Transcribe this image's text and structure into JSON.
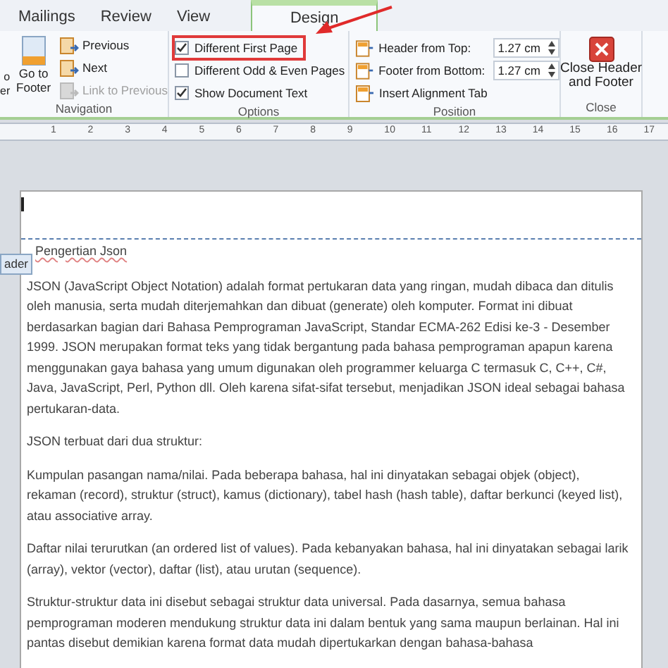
{
  "tabs": [
    {
      "label": "Mailings",
      "selected": false
    },
    {
      "label": "Review",
      "selected": false
    },
    {
      "label": "View",
      "selected": false
    },
    {
      "label": "Design",
      "selected": true
    }
  ],
  "navigation": {
    "label": "Navigation",
    "cut_button": [
      "o",
      "er"
    ],
    "goto": [
      "Go to",
      "Footer"
    ],
    "items": [
      {
        "label": "Previous",
        "disabled": false
      },
      {
        "label": "Next",
        "disabled": false
      },
      {
        "label": "Link to Previous",
        "disabled": true
      }
    ]
  },
  "options": {
    "label": "Options",
    "items": [
      {
        "label": "Different First Page",
        "checked": true,
        "highlighted": true
      },
      {
        "label": "Different Odd & Even Pages",
        "checked": false,
        "highlighted": false
      },
      {
        "label": "Show Document Text",
        "checked": true,
        "highlighted": false
      }
    ]
  },
  "position": {
    "label": "Position",
    "fields": [
      {
        "label": "Header from Top:",
        "value": "1.27 cm"
      },
      {
        "label": "Footer from Bottom:",
        "value": "1.27 cm"
      }
    ],
    "insert": "Insert Alignment Tab"
  },
  "close": {
    "label": "Close",
    "button": [
      "Close Header",
      "and Footer"
    ]
  },
  "ruler": [
    "1",
    "2",
    "3",
    "4",
    "5",
    "6",
    "7",
    "8",
    "9",
    "10",
    "11",
    "12",
    "13",
    "14",
    "15",
    "16",
    "17"
  ],
  "header_tag": "ader",
  "document": {
    "title": "Pengertian Json",
    "paragraphs": [
      "JSON (JavaScript Object Notation) adalah format pertukaran data yang ringan, mudah dibaca dan ditulis oleh manusia, serta mudah diterjemahkan dan dibuat (generate) oleh komputer. Format ini dibuat berdasarkan bagian dari Bahasa Pemprograman JavaScript, Standar ECMA-262 Edisi ke-3 - Desember 1999.  JSON merupakan format teks yang tidak bergantung pada bahasa pemprograman apapun karena menggunakan gaya bahasa yang umum digunakan oleh programmer keluarga C termasuk C, C++, C#, Java, JavaScript, Perl, Python dll.  Oleh karena sifat-sifat tersebut, menjadikan JSON ideal sebagai bahasa pertukaran-data.",
      "JSON terbuat dari dua struktur:",
      "Kumpulan pasangan nama/nilai. Pada beberapa bahasa, hal ini dinyatakan sebagai objek (object), rekaman (record), struktur (struct), kamus (dictionary), tabel hash (hash table), daftar berkunci (keyed list), atau associative array.",
      "Daftar nilai terurutkan (an ordered list of values). Pada kebanyakan bahasa, hal ini dinyatakan sebagai larik (array), vektor (vector), daftar (list), atau urutan (sequence).",
      "Struktur-struktur data ini disebut sebagai struktur data universal. Pada dasarnya, semua bahasa pemprograman moderen mendukung struktur data ini dalam  bentuk yang sama maupun berlainan.  Hal ini pantas disebut demikian karena format data mudah dipertukarkan dengan bahasa-bahasa"
    ]
  }
}
